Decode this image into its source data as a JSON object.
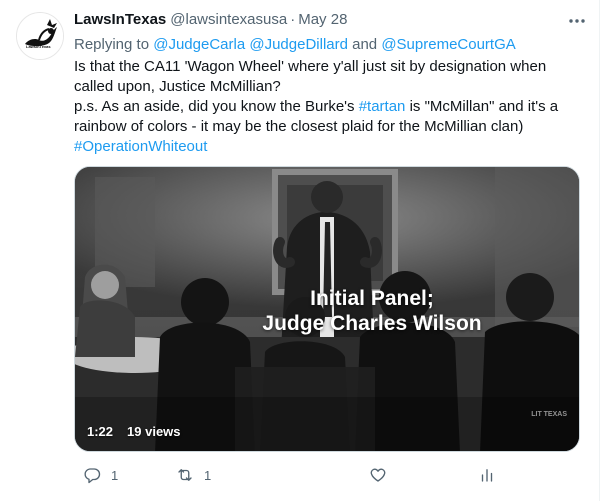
{
  "tweet": {
    "display_name": "LawsInTexas",
    "handle": "@lawsintexasusa",
    "separator": "·",
    "date": "May 28",
    "reply_prefix": "Replying to ",
    "reply_mention_1": "@JudgeCarla",
    "reply_mention_2": "@JudgeDillard",
    "reply_and": " and ",
    "reply_mention_3": "@SupremeCourtGA",
    "line1": "Is that the CA11 'Wagon Wheel' where y'all just sit by designation when called upon, Justice McMillian?",
    "line2_a": "p.s. As an aside, did you know the Burke's ",
    "line2_tag": "#tartan",
    "line2_b": " is \"McMillan\" and it's a rainbow of colors - it may be the closest plaid for the McMillian clan)",
    "hashtag": "#OperationWhiteout",
    "avatar_text": "LawsInTexas"
  },
  "video": {
    "caption_line1": "Initial Panel;",
    "caption_line2": "Judge Charles Wilson",
    "duration": "1:22",
    "views": "19 views",
    "watermark": "LIT TEXAS"
  },
  "actions": {
    "reply_count": "1",
    "retweet_count": "1",
    "like_count": "",
    "icons": [
      "reply-icon",
      "retweet-icon",
      "like-icon",
      "analytics-icon"
    ]
  },
  "colors": {
    "link": "#1d9bf0",
    "muted": "#536471",
    "text": "#0f1419"
  }
}
